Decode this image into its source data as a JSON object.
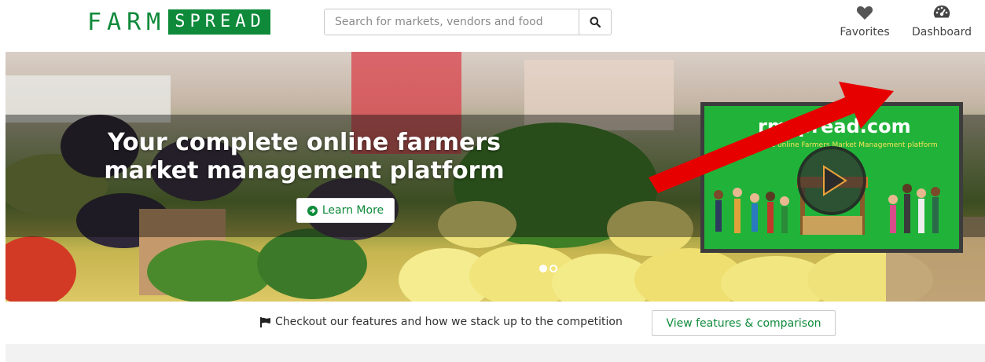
{
  "brand": {
    "logo_part1": "FARM",
    "logo_part2": "SPREAD"
  },
  "search": {
    "placeholder": "Search for markets, vendors and food",
    "button_icon": "search-icon"
  },
  "nav": {
    "favorites": {
      "label": "Favorites",
      "icon": "heart-icon"
    },
    "dashboard": {
      "label": "Dashboard",
      "icon": "dashboard-gauge-icon"
    }
  },
  "hero": {
    "title": "Your complete online farmers market management platform",
    "cta_label": "Learn More",
    "cta_icon": "circle-arrow-right-icon",
    "slides": 2,
    "active_slide": 1,
    "video": {
      "title": "rmspread.com",
      "subtitle": "ur complete online Farmers Market Management platform"
    }
  },
  "features": {
    "text": "Checkout our features and how we stack up to the competition",
    "icon": "flag-icon",
    "button_label": "View features & comparison"
  },
  "colors": {
    "brand_green": "#0e8a3a",
    "video_green": "#21b339",
    "arrow_red": "#e60000"
  }
}
